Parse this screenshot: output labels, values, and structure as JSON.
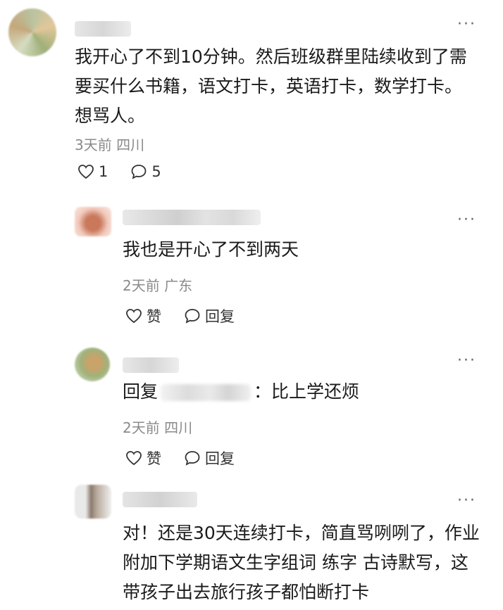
{
  "comments": [
    {
      "text": "我开心了不到10分钟。然后班级群里陆续收到了需要买什么书籍，语文打卡，英语打卡，数学打卡。想骂人。",
      "meta": "3天前 四川",
      "likes": "1",
      "replies": "5",
      "more": "···"
    },
    {
      "text": "我也是开心了不到两天",
      "meta": "2天前 广东",
      "like_label": "赞",
      "reply_label": "回复",
      "more": "···"
    },
    {
      "reply_prefix": "回复",
      "text": "：比上学还烦",
      "meta": "2天前 四川",
      "like_label": "赞",
      "reply_label": "回复",
      "more": "···"
    },
    {
      "text": "对！还是30天连续打卡，简直骂咧咧了，作业附加下学期语文生字组词 练字 古诗默写，这带孩子出去旅行孩子都怕断打卡",
      "more": "···"
    }
  ]
}
